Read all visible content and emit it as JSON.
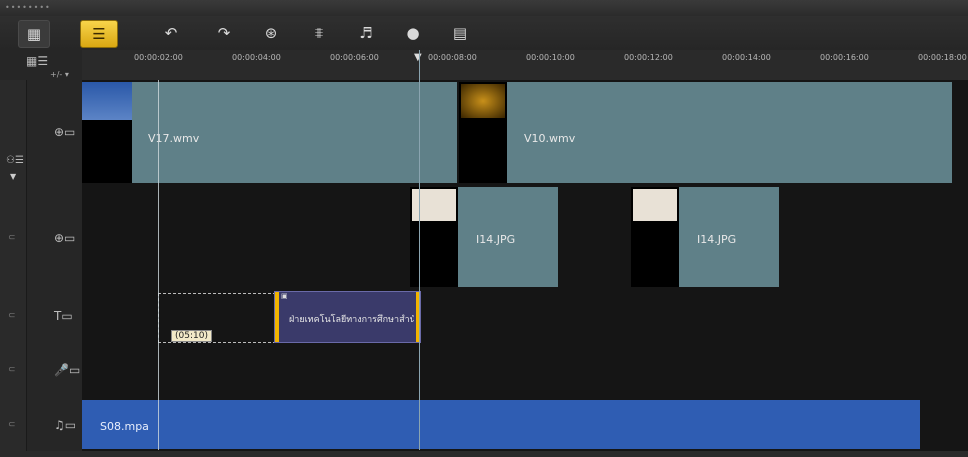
{
  "toolbar": {
    "storyboard_icon": "film-strip-icon",
    "timeline_icon": "timeline-icon",
    "undo_icon": "undo-icon",
    "redo_icon": "redo-icon",
    "record_icon": "record-capture-icon",
    "audio_mixer_icon": "audio-mixer-icon",
    "auto_music_icon": "auto-music-icon",
    "motion_icon": "motion-track-icon",
    "subtitle_icon": "subtitle-icon"
  },
  "ruler": {
    "ticks": [
      "00:00:02:00",
      "00:00:04:00",
      "00:00:06:00",
      "00:00:08:00",
      "00:00:10:00",
      "00:00:12:00",
      "00:00:14:00",
      "00:00:16:00",
      "00:00:18:00"
    ],
    "zoom_label": "+/- ▾"
  },
  "tracks": {
    "video": {
      "clips": [
        "V17.wmv",
        "V10.wmv"
      ]
    },
    "overlay": {
      "clips": [
        "I14.JPG",
        "I14.JPG"
      ]
    },
    "title": {
      "clip_text": "ฝ่ายเทคโนโลยีทางการศึกษาสำนัก",
      "duration_badge": "(05:10)"
    },
    "voice": {
      "clips": []
    },
    "music": {
      "clips": [
        "S08.mpa"
      ]
    }
  },
  "colors": {
    "video_clip": "#5f8088",
    "title_clip": "#3a3a6a",
    "music_clip": "#2f5db3",
    "accent": "#f2b400"
  }
}
